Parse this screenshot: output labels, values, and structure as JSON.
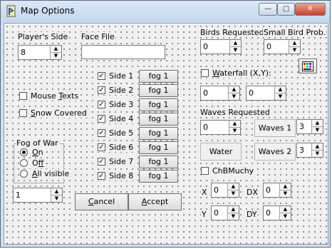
{
  "window": {
    "title": "Map Options"
  },
  "players_side": {
    "label": "Player's Side",
    "value": "8"
  },
  "face_file": {
    "label": "Face File",
    "value": ""
  },
  "sides": [
    {
      "label": "Side 1",
      "fog": "fog 1",
      "checked": true
    },
    {
      "label": "Side 2",
      "fog": "fog 1",
      "checked": true
    },
    {
      "label": "Side 3",
      "fog": "fog 1",
      "checked": true
    },
    {
      "label": "Side 4",
      "fog": "fog 1",
      "checked": true
    },
    {
      "label": "Side 5",
      "fog": "fog 1",
      "checked": true
    },
    {
      "label": "Side 6",
      "fog": "fog 1",
      "checked": true
    },
    {
      "label": "Side 7",
      "fog": "fog 1",
      "checked": true
    },
    {
      "label": "Side 8",
      "fog": "fog 1",
      "checked": true
    }
  ],
  "mouse_texts": {
    "pre": "Mouse ",
    "ul": "T",
    "post": "exts",
    "checked": false
  },
  "snow_covered": {
    "pre": "",
    "ul": "S",
    "post": "now Covered",
    "checked": false
  },
  "fog_of_war": {
    "title": "Fog of War",
    "options": [
      {
        "pre": "",
        "ul": "O",
        "post": "n",
        "selected": true
      },
      {
        "pre": "O",
        "ul": "f",
        "post": "f",
        "selected": false
      },
      {
        "pre": "",
        "ul": "A",
        "post": "ll visible",
        "selected": false
      }
    ],
    "value": "1"
  },
  "buttons": {
    "cancel": {
      "pre": "",
      "ul": "C",
      "post": "ancel"
    },
    "accept": {
      "pre": "",
      "ul": "A",
      "post": "ccept"
    }
  },
  "birds": {
    "label": "Birds Requested",
    "value": "0"
  },
  "small_bird": {
    "label": "Small Bird Prob.",
    "value": "0"
  },
  "waterfall": {
    "pre": "",
    "ul": "W",
    "post": "aterfall (X,Y):",
    "checked": false,
    "x": "0",
    "y": "0"
  },
  "waves": {
    "label": "Waves Requested",
    "value": "0",
    "waves1_label": "Waves 1",
    "waves1_value": "3",
    "water_label": "Water",
    "waves2_label": "Waves 2",
    "waves2_value": "3"
  },
  "chbmuchy": {
    "label": "ChBMuchy",
    "checked": false
  },
  "coords": {
    "x_label": "X",
    "x_value": "0",
    "dx_label": "DX",
    "dx_value": "0",
    "y_label": "Y",
    "y_value": "0",
    "dy_label": "DY",
    "dy_value": "0"
  },
  "icons": {
    "app": "app-icon",
    "palette": "palette-icon"
  }
}
